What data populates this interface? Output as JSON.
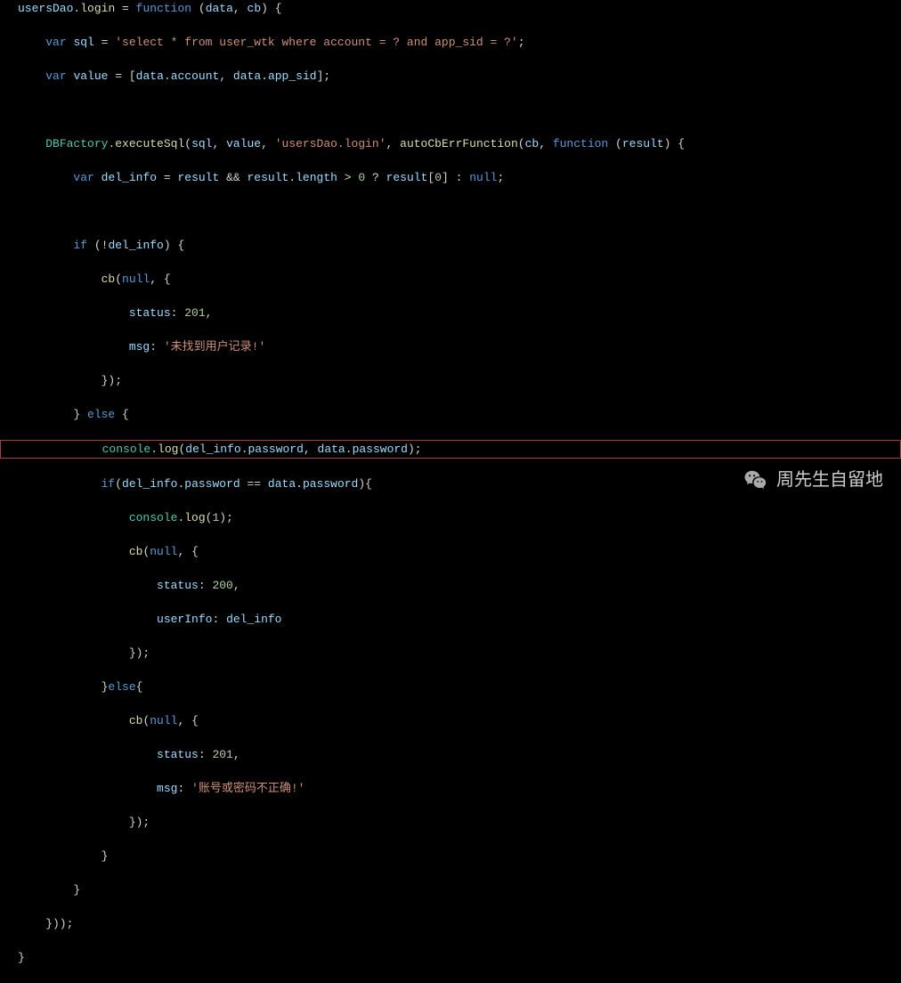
{
  "code": {
    "line1": {
      "a": "usersDao",
      "b": ".",
      "c": "login",
      "d": " = ",
      "e": "function",
      "f": " (",
      "g": "data",
      "h": ", ",
      "i": "cb",
      "j": ") {"
    },
    "line2": {
      "a": "    ",
      "b": "var",
      "c": " ",
      "d": "sql",
      "e": " = ",
      "f": "'select * from user_wtk where account = ? and app_sid = ?'",
      "g": ";"
    },
    "line3": {
      "a": "    ",
      "b": "var",
      "c": " ",
      "d": "value",
      "e": " = [",
      "f": "data",
      "g": ".",
      "h": "account",
      "i": ", ",
      "j": "data",
      "k": ".",
      "l": "app_sid",
      "m": "];"
    },
    "line4": "",
    "line5": {
      "a": "    ",
      "b": "DBFactory",
      "c": ".",
      "d": "executeSql",
      "e": "(",
      "f": "sql",
      "g": ", ",
      "h": "value",
      "i": ", ",
      "j": "'usersDao.login'",
      "k": ", ",
      "l": "autoCbErrFunction",
      "m": "(",
      "n": "cb",
      "o": ", ",
      "p": "function",
      "q": " (",
      "r": "result",
      "s": ") {"
    },
    "line6": {
      "a": "        ",
      "b": "var",
      "c": " ",
      "d": "del_info",
      "e": " = ",
      "f": "result",
      "g": " && ",
      "h": "result",
      "i": ".",
      "j": "length",
      "k": " > ",
      "l": "0",
      "m": " ? ",
      "n": "result",
      "o": "[",
      "p": "0",
      "q": "] : ",
      "r": "null",
      "s": ";"
    },
    "line7": "",
    "line8": {
      "a": "        ",
      "b": "if",
      "c": " (!",
      "d": "del_info",
      "e": ") {"
    },
    "line9": {
      "a": "            ",
      "b": "cb",
      "c": "(",
      "d": "null",
      "e": ", {"
    },
    "line10": {
      "a": "                ",
      "b": "status",
      "c": ": ",
      "d": "201",
      "e": ","
    },
    "line11": {
      "a": "                ",
      "b": "msg",
      "c": ": ",
      "d": "'未找到用户记录!'"
    },
    "line12": {
      "a": "            });"
    },
    "line13": {
      "a": "        } ",
      "b": "else",
      "c": " {"
    },
    "line14": {
      "a": "            ",
      "b": "console",
      "c": ".",
      "d": "log",
      "e": "(",
      "f": "del_info",
      "g": ".",
      "h": "password",
      "i": ", ",
      "j": "data",
      "k": ".",
      "l": "password",
      "m": ");"
    },
    "line15": {
      "a": "            ",
      "b": "if",
      "c": "(",
      "d": "del_info",
      "e": ".",
      "f": "password",
      "g": " == ",
      "h": "data",
      "i": ".",
      "j": "password",
      "k": "){"
    },
    "line16": {
      "a": "                ",
      "b": "console",
      "c": ".",
      "d": "log",
      "e": "(",
      "f": "1",
      "g": ");"
    },
    "line17": {
      "a": "                ",
      "b": "cb",
      "c": "(",
      "d": "null",
      "e": ", {"
    },
    "line18": {
      "a": "                    ",
      "b": "status",
      "c": ": ",
      "d": "200",
      "e": ","
    },
    "line19": {
      "a": "                    ",
      "b": "userInfo",
      "c": ": ",
      "d": "del_info"
    },
    "line20": {
      "a": "                });"
    },
    "line21": {
      "a": "            }",
      "b": "else",
      "c": "{"
    },
    "line22": {
      "a": "                ",
      "b": "cb",
      "c": "(",
      "d": "null",
      "e": ", {"
    },
    "line23": {
      "a": "                    ",
      "b": "status",
      "c": ": ",
      "d": "201",
      "e": ","
    },
    "line24": {
      "a": "                    ",
      "b": "msg",
      "c": ": ",
      "d": "'账号或密码不正确!'"
    },
    "line25": {
      "a": "                });"
    },
    "line26": {
      "a": "            }"
    },
    "line27": {
      "a": "        }"
    },
    "line28": {
      "a": "    }));"
    },
    "line29": {
      "a": "}"
    }
  },
  "watermark": "周先生自留地"
}
